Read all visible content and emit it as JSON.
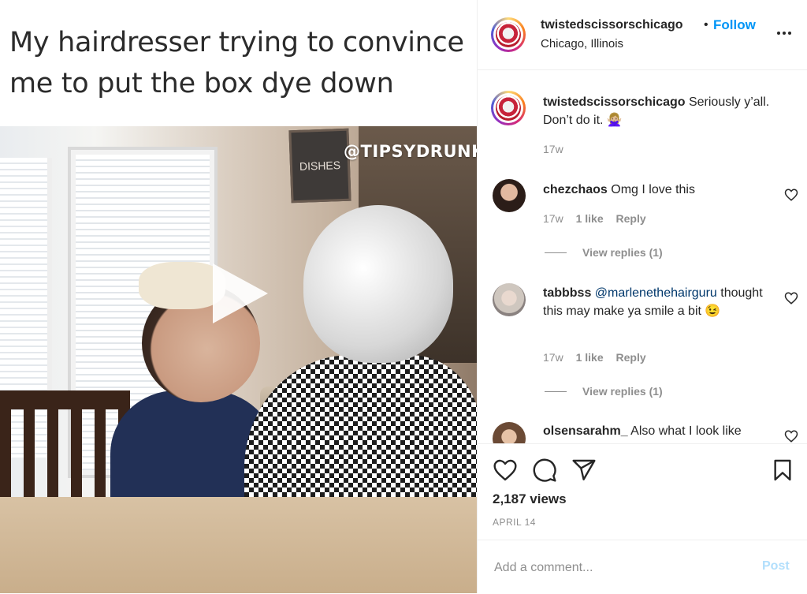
{
  "media": {
    "caption": "My hairdresser trying to convince me to put the box dye down",
    "watermark": "@TIPSYDRUNK",
    "sign_text": "DISHES"
  },
  "header": {
    "username": "twistedscissorschicago",
    "separator": "•",
    "follow_label": "Follow",
    "location": "Chicago, Illinois"
  },
  "caption_comment": {
    "username": "twistedscissorschicago",
    "text": "Seriously y’all. Don’t do it. 🙅🏼‍♀️",
    "time": "17w"
  },
  "comments": [
    {
      "username": "chezchaos",
      "text": "Omg I love this",
      "time": "17w",
      "likes": "1 like",
      "reply_label": "Reply",
      "view_replies": "View replies (1)"
    },
    {
      "username": "tabbbss",
      "mention": "@marlenethehairguru",
      "text": "thought this may make ya smile a bit 😉",
      "time": "17w",
      "likes": "1 like",
      "reply_label": "Reply",
      "view_replies": "View replies (1)"
    },
    {
      "username": "olsensarahm_",
      "text": "Also what I look like"
    }
  ],
  "actions": {
    "icons": [
      "heart-icon",
      "comment-icon",
      "share-icon",
      "bookmark-icon"
    ],
    "views": "2,187 views",
    "date": "APRIL 14"
  },
  "add_comment": {
    "placeholder": "Add a comment...",
    "post_label": "Post"
  },
  "colors": {
    "accent": "#0095f6",
    "post_disabled": "#b2dffc",
    "muted": "#8e8e8e",
    "text": "#262626",
    "mention": "#00376b"
  }
}
